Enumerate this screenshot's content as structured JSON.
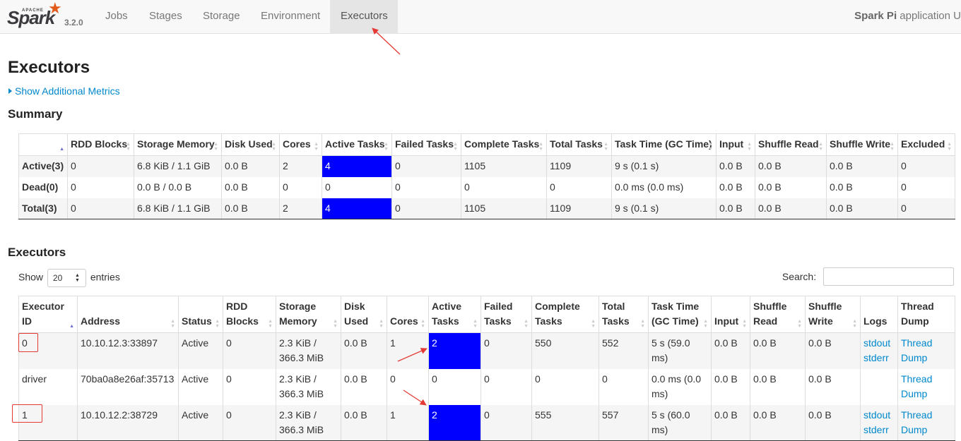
{
  "brand": {
    "apache": "APACHE",
    "spark": "Spark",
    "version": "3.2.0"
  },
  "nav": {
    "tabs": [
      "Jobs",
      "Stages",
      "Storage",
      "Environment",
      "Executors"
    ],
    "app_label": "Spark Pi",
    "app_suffix": " application U"
  },
  "page_title": "Executors",
  "metrics_link": "Show Additional Metrics",
  "summary": {
    "title": "Summary",
    "headers": [
      "",
      "RDD Blocks",
      "Storage Memory",
      "Disk Used",
      "Cores",
      "Active Tasks",
      "Failed Tasks",
      "Complete Tasks",
      "Total Tasks",
      "Task Time (GC Time)",
      "Input",
      "Shuffle Read",
      "Shuffle Write",
      "Excluded"
    ],
    "rows": [
      [
        "Active(3)",
        "0",
        "6.8 KiB / 1.1 GiB",
        "0.0 B",
        "2",
        "4",
        "0",
        "1105",
        "1109",
        "9 s (0.1 s)",
        "0.0 B",
        "0.0 B",
        "0.0 B",
        "0"
      ],
      [
        "Dead(0)",
        "0",
        "0.0 B / 0.0 B",
        "0.0 B",
        "0",
        "0",
        "0",
        "0",
        "0",
        "0.0 ms (0.0 ms)",
        "0.0 B",
        "0.0 B",
        "0.0 B",
        "0"
      ],
      [
        "Total(3)",
        "0",
        "6.8 KiB / 1.1 GiB",
        "0.0 B",
        "2",
        "4",
        "0",
        "1105",
        "1109",
        "9 s (0.1 s)",
        "0.0 B",
        "0.0 B",
        "0.0 B",
        "0"
      ]
    ]
  },
  "executors": {
    "title": "Executors",
    "show_label": "Show",
    "entries_value": "20",
    "entries_label": "entries",
    "search_label": "Search:",
    "search_value": "",
    "headers": [
      "Executor ID",
      "Address",
      "Status",
      "RDD Blocks",
      "Storage Memory",
      "Disk Used",
      "Cores",
      "Active Tasks",
      "Failed Tasks",
      "Complete Tasks",
      "Total Tasks",
      "Task Time (GC Time)",
      "Input",
      "Shuffle Read",
      "Shuffle Write",
      "Logs",
      "Thread Dump"
    ],
    "rows": [
      [
        "0",
        "10.10.12.3:33897",
        "Active",
        "0",
        "2.3 KiB / 366.3 MiB",
        "0.0 B",
        "1",
        "2",
        "0",
        "550",
        "552",
        "5 s (59.0 ms)",
        "0.0 B",
        "0.0 B",
        "0.0 B",
        [
          "stdout",
          "stderr"
        ],
        "Thread Dump"
      ],
      [
        "driver",
        "70ba0a8e26af:35713",
        "Active",
        "0",
        "2.3 KiB / 366.3 MiB",
        "0.0 B",
        "0",
        "0",
        "0",
        "0",
        "0",
        "0.0 ms (0.0 ms)",
        "0.0 B",
        "0.0 B",
        "0.0 B",
        [],
        "Thread Dump"
      ],
      [
        "1",
        "10.10.12.2:38729",
        "Active",
        "0",
        "2.3 KiB / 366.3 MiB",
        "0.0 B",
        "1",
        "2",
        "0",
        "555",
        "557",
        "5 s (60.0 ms)",
        "0.0 B",
        "0.0 B",
        "0.0 B",
        [
          "stdout",
          "stderr"
        ],
        "Thread Dump"
      ]
    ]
  },
  "colors": {
    "highlight": "#0000ff",
    "annotation": "#e53935",
    "link": "#0088cc"
  }
}
